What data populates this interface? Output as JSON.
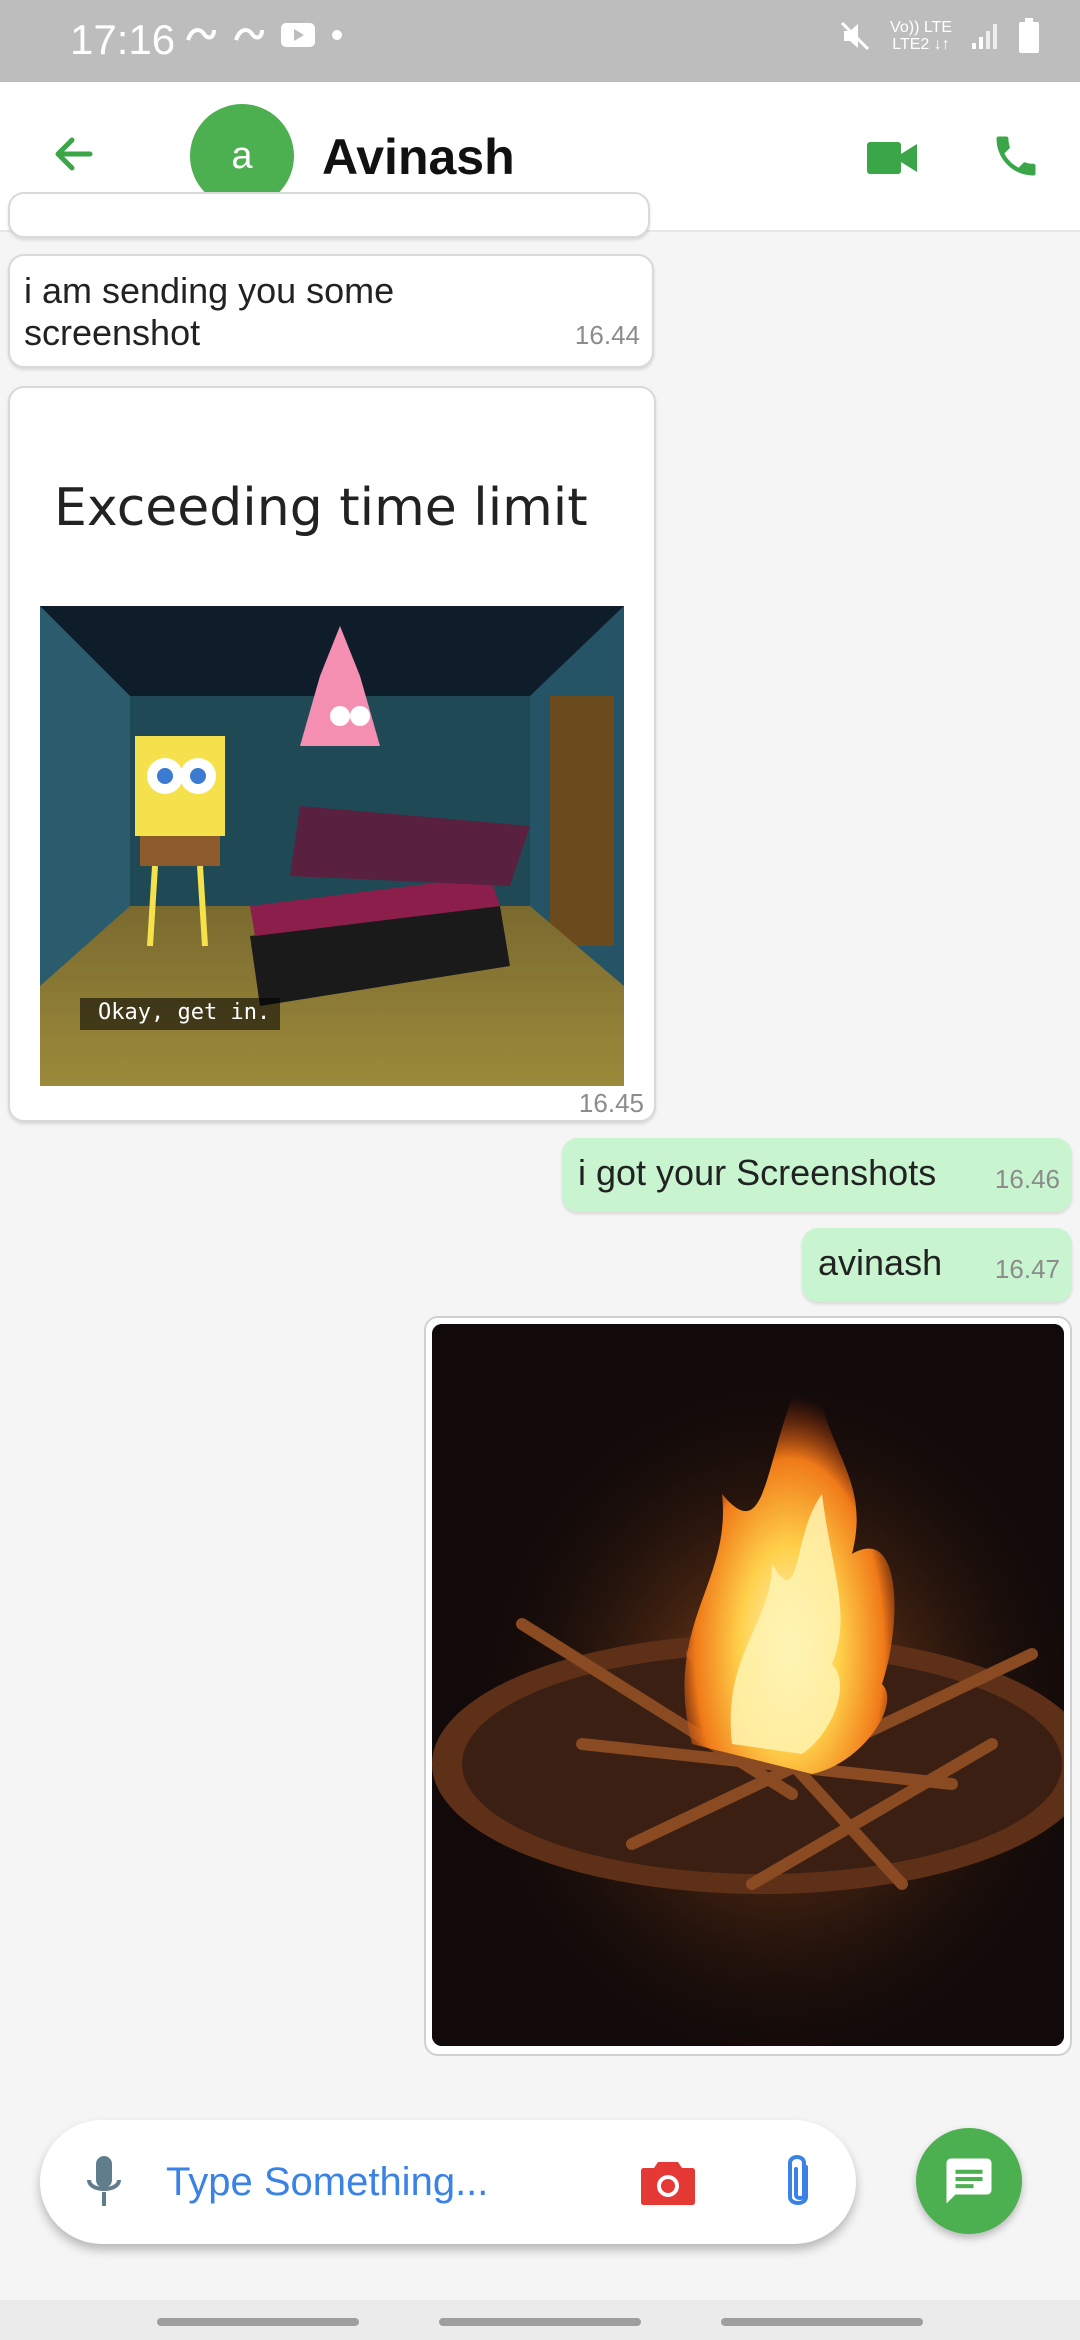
{
  "status_bar": {
    "time": "17:16",
    "network_label": "Vo)) LTE\nLTE2 ↓↑",
    "icons": [
      "sync-icon",
      "sync-icon",
      "youtube-icon",
      "dot-icon",
      "mute-icon",
      "signal-icon",
      "battery-icon"
    ]
  },
  "header": {
    "avatar_letter": "a",
    "contact_name": "Avinash",
    "icons": [
      "back-arrow-icon",
      "video-call-icon",
      "phone-icon"
    ]
  },
  "messages": [
    {
      "type": "text",
      "direction": "received",
      "text": "i am sending you some\nscreenshot",
      "time": "16.44"
    },
    {
      "type": "image",
      "direction": "received",
      "caption_title": "Exceeding time limit",
      "subtitle_overlay": "Okay, get in.",
      "time": "16.45"
    },
    {
      "type": "text",
      "direction": "sent",
      "text": "i got your Screenshots",
      "time": "16.46"
    },
    {
      "type": "text",
      "direction": "sent",
      "text": "avinash",
      "time": "16.47"
    },
    {
      "type": "image",
      "direction": "sent",
      "description": "campfire photo"
    }
  ],
  "composer": {
    "placeholder": "Type Something...",
    "icons": [
      "mic-icon",
      "camera-icon",
      "paperclip-icon",
      "message-send-icon"
    ]
  },
  "colors": {
    "accent": "#4caf50",
    "sent_bubble": "#c8f5cf",
    "input_text": "#3b82e6",
    "camera": "#e53935"
  }
}
